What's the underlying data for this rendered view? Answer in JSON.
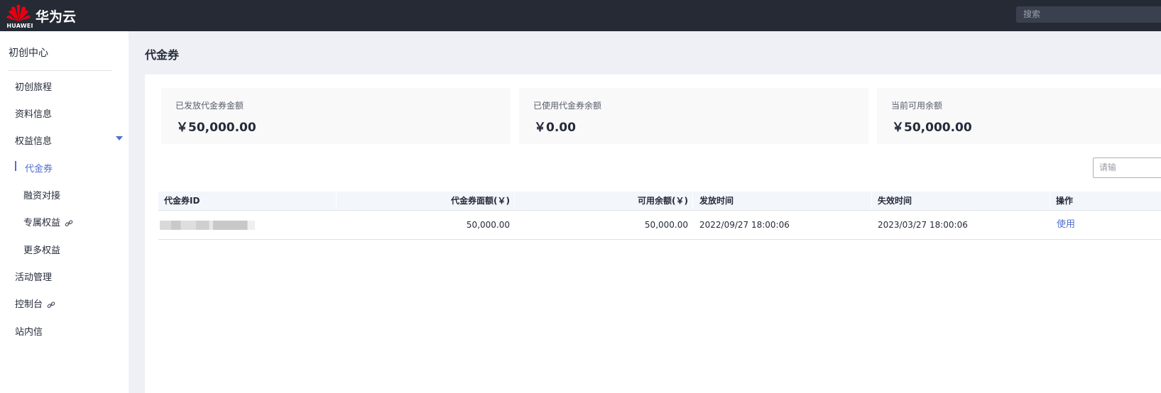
{
  "header": {
    "logo_text": "HUAWEI",
    "brand": "华为云",
    "search_placeholder": "搜索"
  },
  "sidebar": {
    "title": "初创中心",
    "items": [
      {
        "label": "初创旅程"
      },
      {
        "label": "资料信息"
      },
      {
        "label": "权益信息"
      },
      {
        "label": "代金券"
      },
      {
        "label": "融资对接"
      },
      {
        "label": "专属权益"
      },
      {
        "label": "更多权益"
      },
      {
        "label": "活动管理"
      },
      {
        "label": "控制台"
      },
      {
        "label": "站内信"
      }
    ]
  },
  "main": {
    "title": "代金券",
    "cards": [
      {
        "label": "已发放代金券金额",
        "value": "￥50,000.00"
      },
      {
        "label": "已使用代金券余额",
        "value": "￥0.00"
      },
      {
        "label": "当前可用余额",
        "value": "￥50,000.00"
      }
    ],
    "filter_placeholder": "请输",
    "table": {
      "columns": [
        "代金券ID",
        "代金券面额(￥)",
        "可用余额(￥)",
        "发放时间",
        "失效时间",
        "操作"
      ],
      "rows": [
        {
          "id": "",
          "face_value": "50,000.00",
          "balance": "50,000.00",
          "issued": "2022/09/27 18:00:06",
          "expires": "2023/03/27 18:00:06",
          "action": "使用"
        }
      ]
    }
  },
  "colors": {
    "topbar": "#252a35",
    "accent": "#526ecc",
    "page_bg": "#eef0f5"
  }
}
